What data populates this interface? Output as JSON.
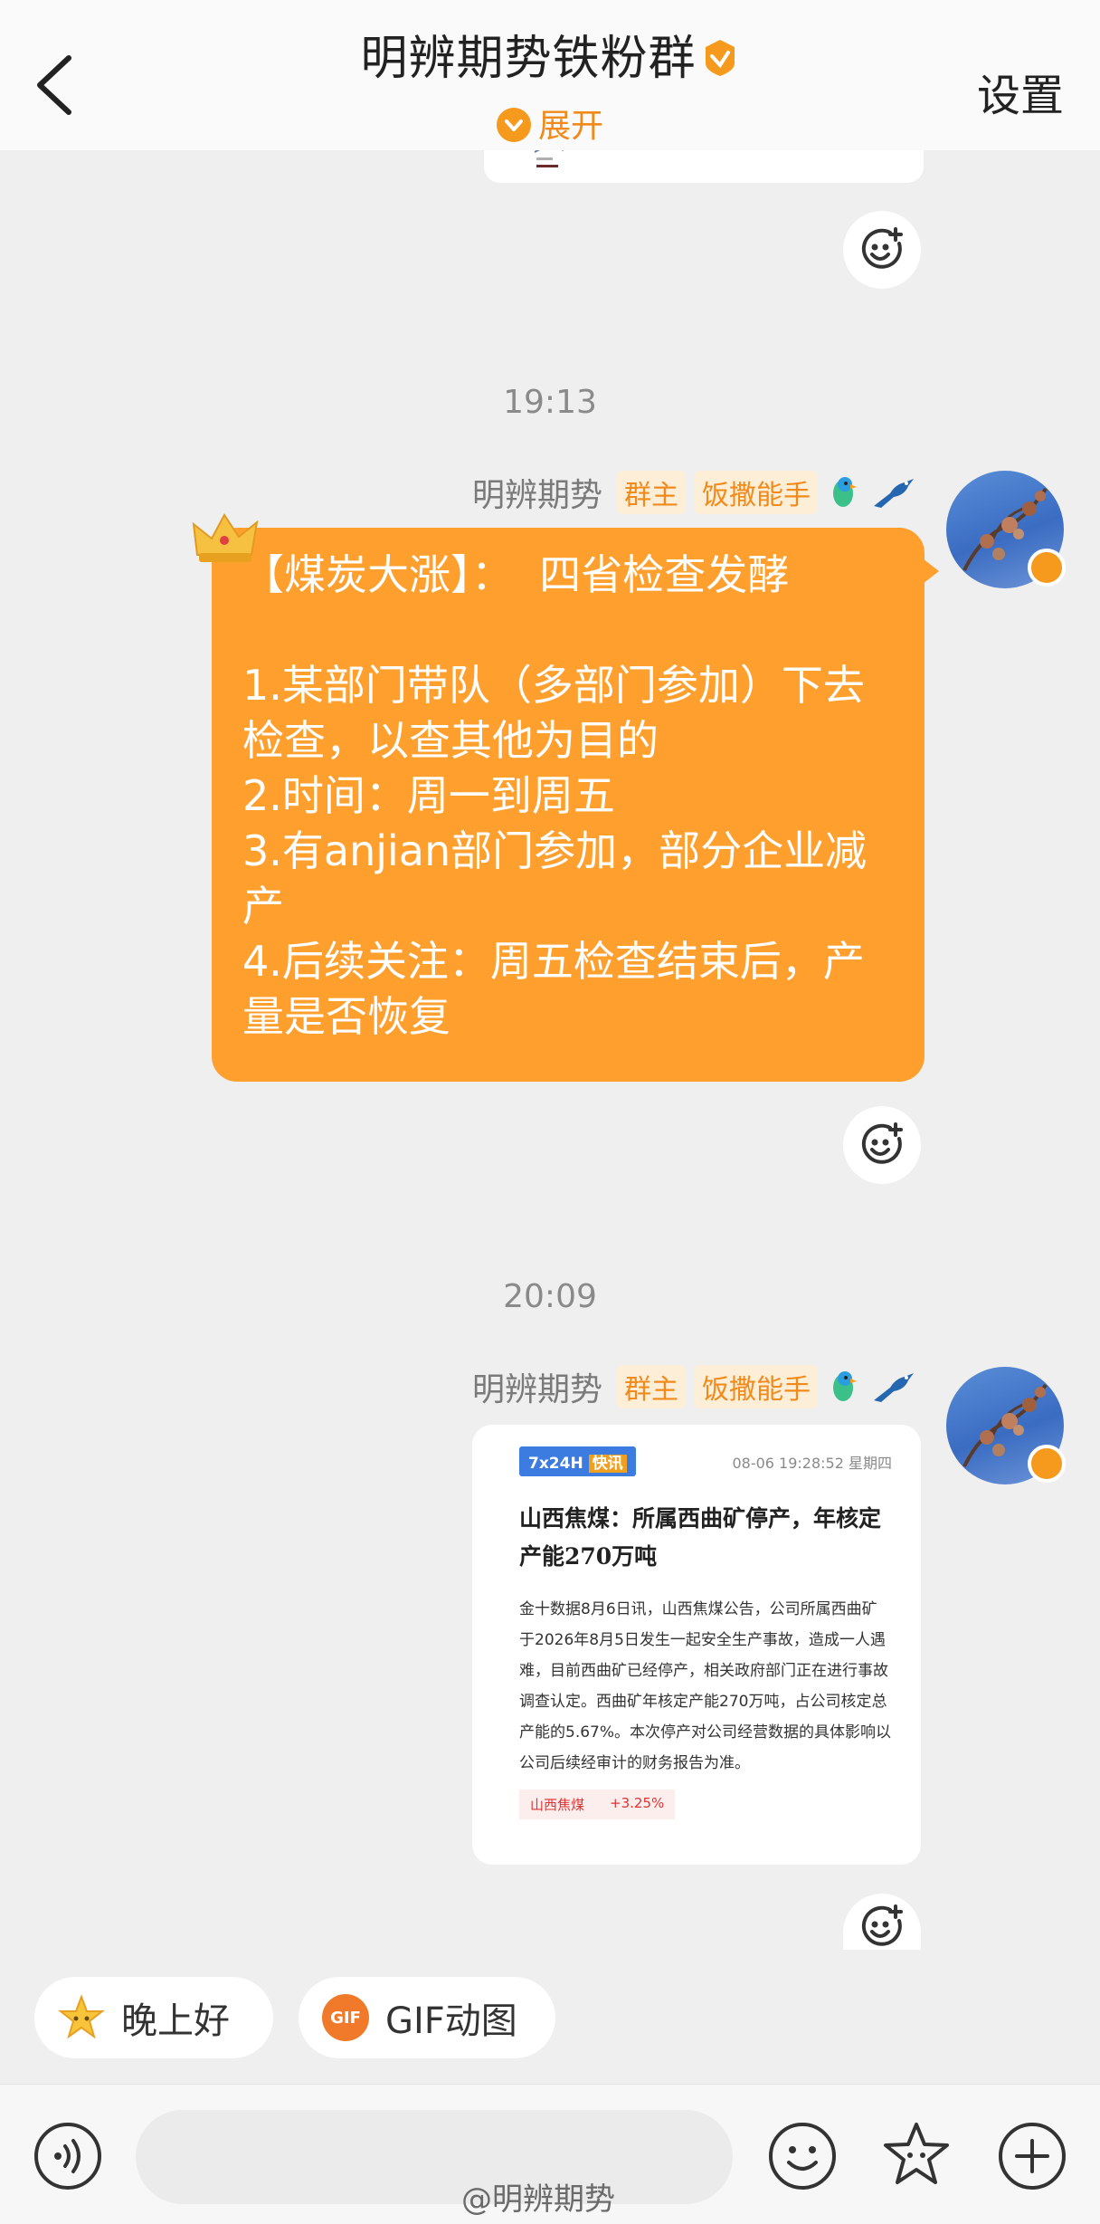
{
  "header": {
    "title": "明辨期势铁粉群",
    "expand_label": "展开",
    "settings_label": "设置"
  },
  "messages": [
    {
      "time": "19:13",
      "sender": "明辨期势",
      "tags": [
        "群主",
        "饭撒能手"
      ],
      "text": "【煤炭大涨】：  四省检查发酵\n\n1.某部门带队（多部门参加）下去检查，以查其他为目的\n2.时间：周一到周五\n3.有anjian部门参加，部分企业减产\n4.后续关注：周五检查结束后，产量是否恢复"
    },
    {
      "time": "20:09",
      "sender": "明辨期势",
      "tags": [
        "群主",
        "饭撒能手"
      ],
      "image": {
        "logo": "7x24H",
        "logo_tag": "快讯",
        "timestamp": "08-06 19:28:52 星期四",
        "headline": "山西焦煤：所属西曲矿停产，年核定产能270万吨",
        "body": "金十数据8月6日讯，山西焦煤公告，公司所属西曲矿于2026年8月5日发生一起安全生产事故，造成一人遇难，目前西曲矿已经停产，相关政府部门正在进行事故调查认定。西曲矿年核定产能270万吨，占公司核定总产能的5.67%。本次停产对公司经营数据的具体影响以公司后续经审计的财务报告为准。",
        "stock_name": "山西焦煤",
        "stock_change": "+3.25%"
      }
    }
  ],
  "quick_replies": [
    "晚上好",
    "GIF动图"
  ],
  "watermark": "@明辨期势",
  "colors": {
    "accent": "#ff9f2e",
    "tag_bg": "#fdeed8",
    "tag_text": "#f08a1a"
  },
  "icons": [
    "back-arrow-icon",
    "verified-icon",
    "chevron-down-icon",
    "add-reaction-icon",
    "voice-icon",
    "emoji-icon",
    "sticker-icon",
    "plus-icon"
  ]
}
